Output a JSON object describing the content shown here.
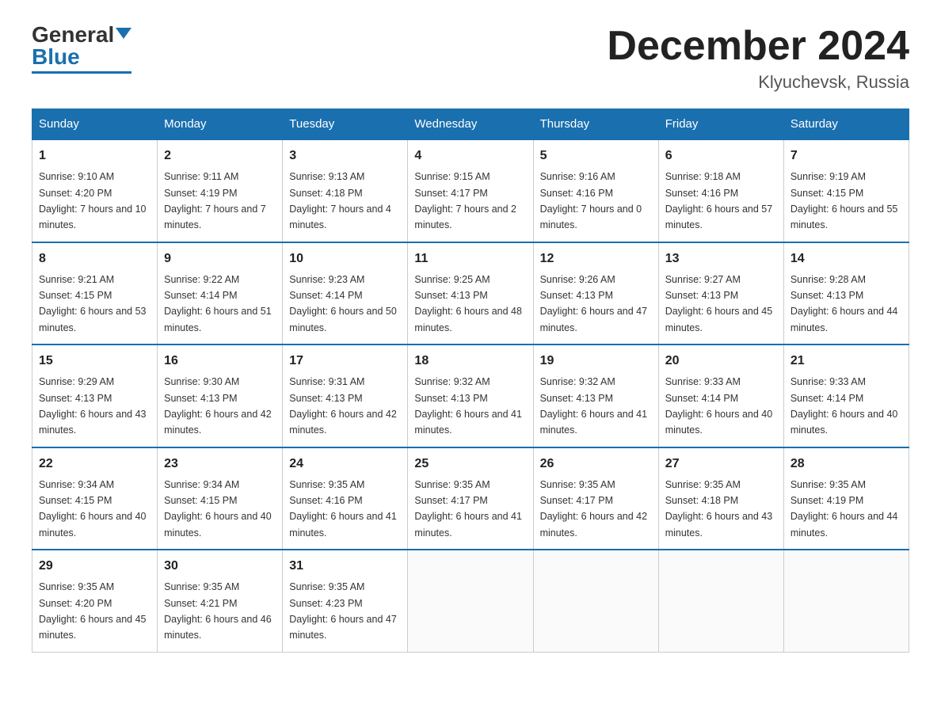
{
  "header": {
    "logo_text1": "General",
    "logo_text2": "Blue",
    "month_title": "December 2024",
    "location": "Klyuchevsk, Russia"
  },
  "days_of_week": [
    "Sunday",
    "Monday",
    "Tuesday",
    "Wednesday",
    "Thursday",
    "Friday",
    "Saturday"
  ],
  "weeks": [
    [
      {
        "day": "1",
        "sunrise": "9:10 AM",
        "sunset": "4:20 PM",
        "daylight": "7 hours and 10 minutes."
      },
      {
        "day": "2",
        "sunrise": "9:11 AM",
        "sunset": "4:19 PM",
        "daylight": "7 hours and 7 minutes."
      },
      {
        "day": "3",
        "sunrise": "9:13 AM",
        "sunset": "4:18 PM",
        "daylight": "7 hours and 4 minutes."
      },
      {
        "day": "4",
        "sunrise": "9:15 AM",
        "sunset": "4:17 PM",
        "daylight": "7 hours and 2 minutes."
      },
      {
        "day": "5",
        "sunrise": "9:16 AM",
        "sunset": "4:16 PM",
        "daylight": "7 hours and 0 minutes."
      },
      {
        "day": "6",
        "sunrise": "9:18 AM",
        "sunset": "4:16 PM",
        "daylight": "6 hours and 57 minutes."
      },
      {
        "day": "7",
        "sunrise": "9:19 AM",
        "sunset": "4:15 PM",
        "daylight": "6 hours and 55 minutes."
      }
    ],
    [
      {
        "day": "8",
        "sunrise": "9:21 AM",
        "sunset": "4:15 PM",
        "daylight": "6 hours and 53 minutes."
      },
      {
        "day": "9",
        "sunrise": "9:22 AM",
        "sunset": "4:14 PM",
        "daylight": "6 hours and 51 minutes."
      },
      {
        "day": "10",
        "sunrise": "9:23 AM",
        "sunset": "4:14 PM",
        "daylight": "6 hours and 50 minutes."
      },
      {
        "day": "11",
        "sunrise": "9:25 AM",
        "sunset": "4:13 PM",
        "daylight": "6 hours and 48 minutes."
      },
      {
        "day": "12",
        "sunrise": "9:26 AM",
        "sunset": "4:13 PM",
        "daylight": "6 hours and 47 minutes."
      },
      {
        "day": "13",
        "sunrise": "9:27 AM",
        "sunset": "4:13 PM",
        "daylight": "6 hours and 45 minutes."
      },
      {
        "day": "14",
        "sunrise": "9:28 AM",
        "sunset": "4:13 PM",
        "daylight": "6 hours and 44 minutes."
      }
    ],
    [
      {
        "day": "15",
        "sunrise": "9:29 AM",
        "sunset": "4:13 PM",
        "daylight": "6 hours and 43 minutes."
      },
      {
        "day": "16",
        "sunrise": "9:30 AM",
        "sunset": "4:13 PM",
        "daylight": "6 hours and 42 minutes."
      },
      {
        "day": "17",
        "sunrise": "9:31 AM",
        "sunset": "4:13 PM",
        "daylight": "6 hours and 42 minutes."
      },
      {
        "day": "18",
        "sunrise": "9:32 AM",
        "sunset": "4:13 PM",
        "daylight": "6 hours and 41 minutes."
      },
      {
        "day": "19",
        "sunrise": "9:32 AM",
        "sunset": "4:13 PM",
        "daylight": "6 hours and 41 minutes."
      },
      {
        "day": "20",
        "sunrise": "9:33 AM",
        "sunset": "4:14 PM",
        "daylight": "6 hours and 40 minutes."
      },
      {
        "day": "21",
        "sunrise": "9:33 AM",
        "sunset": "4:14 PM",
        "daylight": "6 hours and 40 minutes."
      }
    ],
    [
      {
        "day": "22",
        "sunrise": "9:34 AM",
        "sunset": "4:15 PM",
        "daylight": "6 hours and 40 minutes."
      },
      {
        "day": "23",
        "sunrise": "9:34 AM",
        "sunset": "4:15 PM",
        "daylight": "6 hours and 40 minutes."
      },
      {
        "day": "24",
        "sunrise": "9:35 AM",
        "sunset": "4:16 PM",
        "daylight": "6 hours and 41 minutes."
      },
      {
        "day": "25",
        "sunrise": "9:35 AM",
        "sunset": "4:17 PM",
        "daylight": "6 hours and 41 minutes."
      },
      {
        "day": "26",
        "sunrise": "9:35 AM",
        "sunset": "4:17 PM",
        "daylight": "6 hours and 42 minutes."
      },
      {
        "day": "27",
        "sunrise": "9:35 AM",
        "sunset": "4:18 PM",
        "daylight": "6 hours and 43 minutes."
      },
      {
        "day": "28",
        "sunrise": "9:35 AM",
        "sunset": "4:19 PM",
        "daylight": "6 hours and 44 minutes."
      }
    ],
    [
      {
        "day": "29",
        "sunrise": "9:35 AM",
        "sunset": "4:20 PM",
        "daylight": "6 hours and 45 minutes."
      },
      {
        "day": "30",
        "sunrise": "9:35 AM",
        "sunset": "4:21 PM",
        "daylight": "6 hours and 46 minutes."
      },
      {
        "day": "31",
        "sunrise": "9:35 AM",
        "sunset": "4:23 PM",
        "daylight": "6 hours and 47 minutes."
      },
      null,
      null,
      null,
      null
    ]
  ]
}
